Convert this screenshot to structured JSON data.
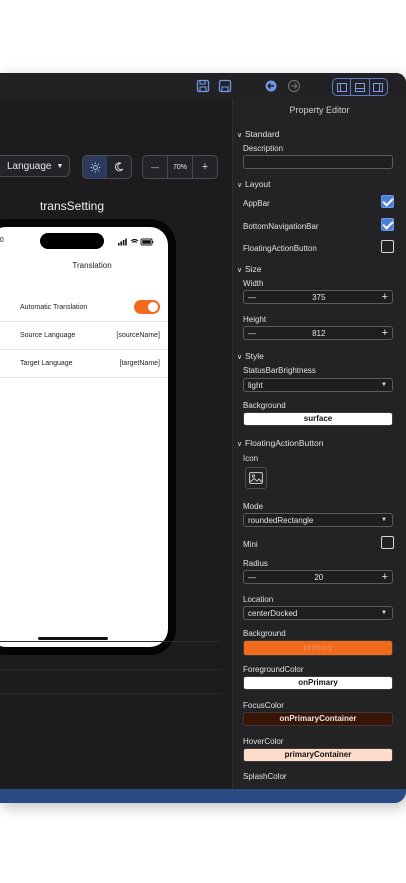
{
  "toolbar": {
    "language_label": "Language",
    "zoom_minus": "—",
    "zoom_value": "70%",
    "zoom_plus": "+"
  },
  "canvas": {
    "screen_title": "transSetting"
  },
  "phone": {
    "time": "00",
    "appbar_title": "Translation",
    "rows": [
      {
        "label": "Automatic Translation",
        "value": ""
      },
      {
        "label": "Source Language",
        "value": "[sourceName]"
      },
      {
        "label": "Target Language",
        "value": "[targetName]"
      }
    ],
    "toggle_on": true
  },
  "panel": {
    "title": "Property Editor",
    "standard": {
      "section": "Standard",
      "description_label": "Description",
      "description_value": ""
    },
    "layout": {
      "section": "Layout",
      "appbar_label": "AppBar",
      "appbar_checked": true,
      "bottomnav_label": "BottomNavigationBar",
      "bottomnav_checked": true,
      "fab_label": "FloatingActionButton",
      "fab_checked": false
    },
    "size": {
      "section": "Size",
      "width_label": "Width",
      "width_value": "375",
      "height_label": "Height",
      "height_value": "812",
      "minus": "—",
      "plus": "+"
    },
    "style": {
      "section": "Style",
      "statusbar_label": "StatusBarBrightness",
      "statusbar_value": "light",
      "background_label": "Background",
      "background_value": "surface"
    },
    "fab": {
      "section": "FloatingActionButton",
      "icon_label": "Icon",
      "mode_label": "Mode",
      "mode_value": "roundedRectangle",
      "mini_label": "Mini",
      "mini_checked": false,
      "radius_label": "Radius",
      "radius_value": "20",
      "location_label": "Location",
      "location_value": "centerDocked",
      "background_label": "Background",
      "background_value": "primary",
      "foreground_label": "ForegroundColor",
      "foreground_value": "onPrimary",
      "focus_label": "FocusColor",
      "focus_value": "onPrimaryContainer",
      "hover_label": "HoverColor",
      "hover_value": "primaryContainer",
      "splash_label": "SplashColor"
    }
  },
  "colors": {
    "accent": "#f26a1b",
    "selection_blue": "#4a7fd6",
    "surface": "#ffffff",
    "primary": "#f26a1b",
    "onPrimary": "#ffffff",
    "onPrimaryContainer": "#3a1506",
    "primaryContainer": "#ffdbc9"
  }
}
